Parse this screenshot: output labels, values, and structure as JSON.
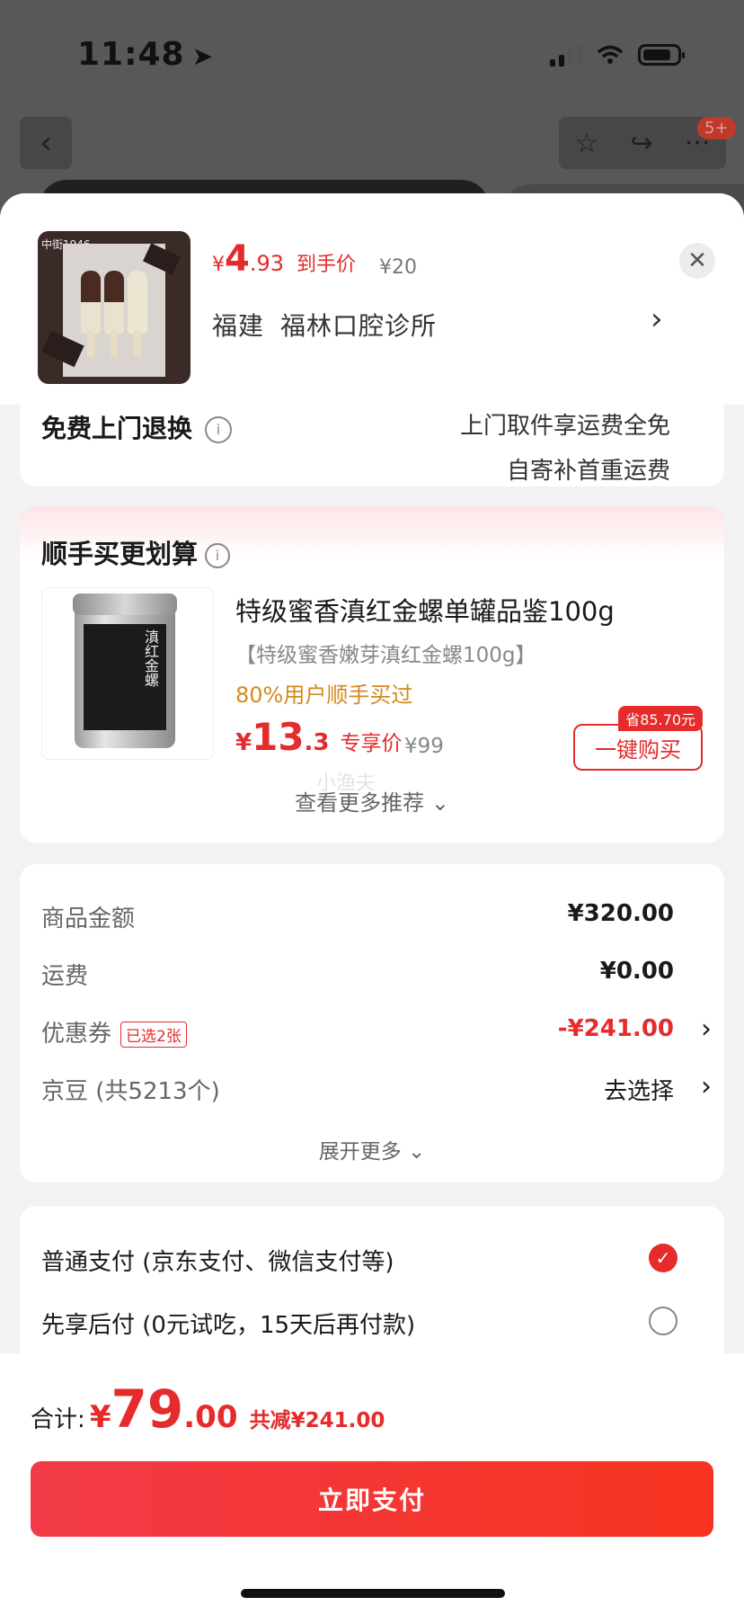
{
  "status_bar": {
    "time": "11:48"
  },
  "nav": {
    "badge": "5+"
  },
  "header": {
    "image_label": "中街1946",
    "price_symbol": "¥",
    "price_int": "4",
    "price_dec": ".93",
    "price_tag": "到手价",
    "original_price": "¥20",
    "store_region": "福建",
    "store_name": "福林口腔诊所"
  },
  "return_service": {
    "label": "免费上门退换",
    "line1": "上门取件享运费全免",
    "line2": "自寄补首重运费"
  },
  "recommend": {
    "title": "顺手买更划算",
    "product_name": "特级蜜香滇红金螺单罐品鉴100g",
    "product_sub": "【特级蜜香嫩芽滇红金螺100g】",
    "stat": "80%用户顺手买过",
    "price_symbol": "¥",
    "price_int": "13",
    "price_dec": ".3",
    "price_tag": "专享价",
    "original_price": "¥99",
    "save_badge": "省85.70元",
    "buy_label": "一键购买",
    "more_label": "查看更多推荐",
    "watermark": "小渔夫",
    "can_text": "滇红金螺"
  },
  "summary": {
    "rows": [
      {
        "label": "商品金额",
        "value": "¥320.00"
      },
      {
        "label": "运费",
        "value": "¥0.00"
      },
      {
        "label": "优惠券",
        "badge": "已选2张",
        "value": "-¥241.00"
      },
      {
        "label": "京豆 (共5213个)",
        "value": "去选择"
      }
    ],
    "more_label": "展开更多"
  },
  "payment": {
    "options": [
      {
        "label": "普通支付 (京东支付、微信支付等)",
        "selected": true
      },
      {
        "label": "先享后付 (0元试吃，15天后再付款)",
        "selected": false
      }
    ]
  },
  "footer": {
    "total_label": "合计:",
    "total_symbol": "¥",
    "total_int": "79",
    "total_dec": ".00",
    "saved": "共减¥241.00",
    "pay_button": "立即支付"
  },
  "colors": {
    "accent": "#e52b2b",
    "warning": "#d4891f"
  }
}
